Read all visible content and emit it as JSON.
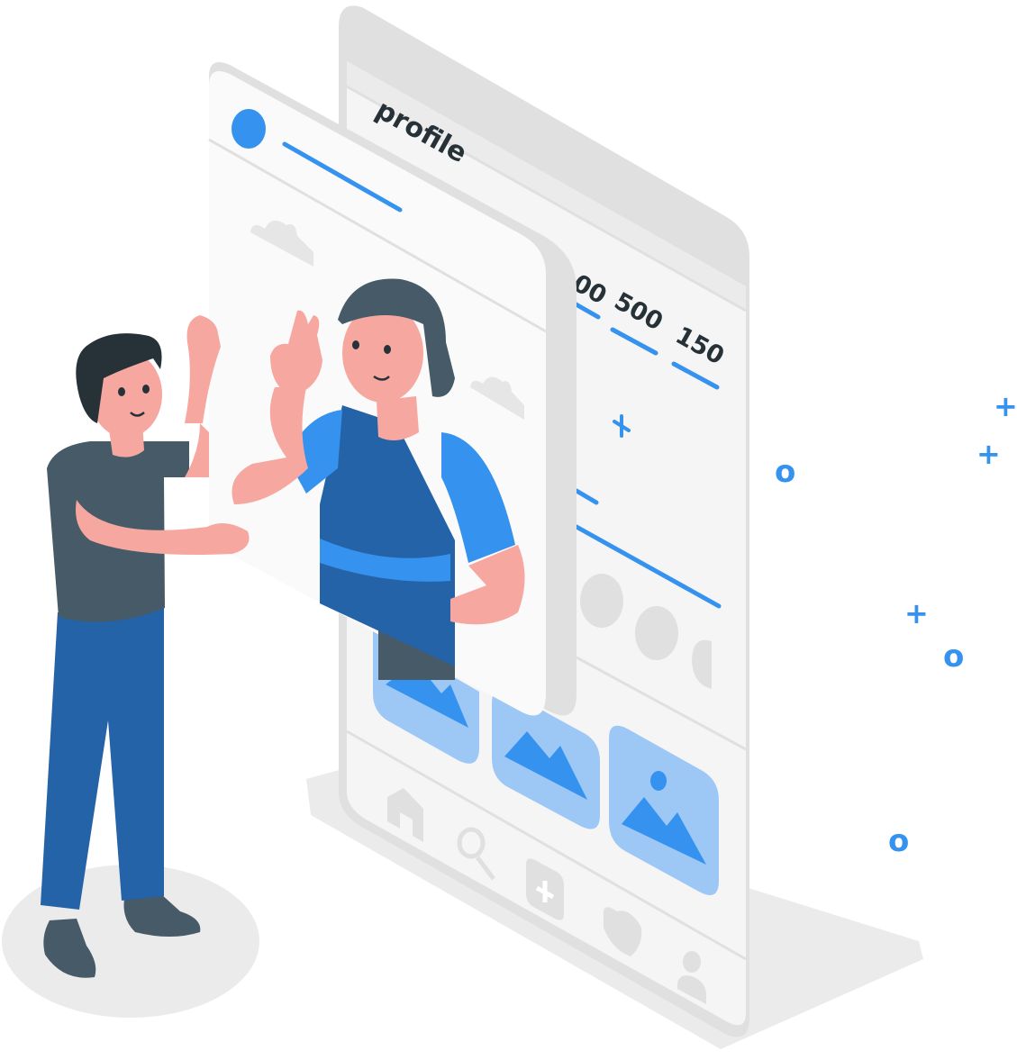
{
  "profile_screen": {
    "title": "profile",
    "stats": [
      "00",
      "500",
      "150"
    ]
  },
  "decorations": {
    "symbols": [
      "+",
      "o",
      "+",
      "+",
      "+",
      "o",
      "o",
      "o"
    ]
  },
  "colors": {
    "accent_blue": "#3592EE",
    "light_blue": "#9DC8F6",
    "phone_gray": "#E0E0E0",
    "screen_white": "#F5F5F5",
    "skin": "#F5A7A0",
    "shirt_dark": "#465A67",
    "pants_blue": "#2563A8"
  }
}
